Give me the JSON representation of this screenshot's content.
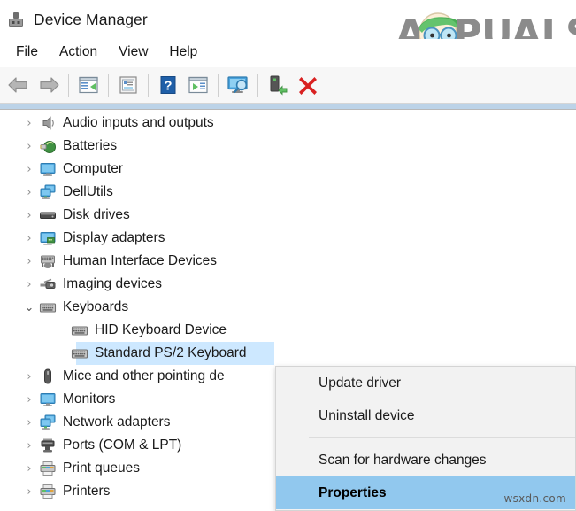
{
  "window": {
    "title": "Device Manager",
    "title_icon": "device-manager-icon"
  },
  "brand": {
    "text": "APPUALS",
    "logo_icon": "appuals-mascot-icon",
    "color": "#8b8b8b"
  },
  "menubar": {
    "items": [
      {
        "label": "File"
      },
      {
        "label": "Action"
      },
      {
        "label": "View"
      },
      {
        "label": "Help"
      }
    ]
  },
  "toolbar": {
    "buttons": [
      {
        "name": "back-button",
        "icon": "back-arrow-icon"
      },
      {
        "name": "forward-button",
        "icon": "forward-arrow-icon"
      },
      {
        "name": "show-hide-console-tree-button",
        "icon": "console-tree-icon"
      },
      {
        "name": "properties-button",
        "icon": "properties-window-icon"
      },
      {
        "name": "help-button",
        "icon": "help-question-icon"
      },
      {
        "name": "update-driver-button",
        "icon": "update-driver-icon"
      },
      {
        "name": "scan-hardware-changes-button",
        "icon": "monitor-magnifier-icon"
      },
      {
        "name": "disable-device-button",
        "icon": "disable-device-icon"
      },
      {
        "name": "uninstall-device-button",
        "icon": "red-x-icon"
      }
    ]
  },
  "tree": {
    "nodes": [
      {
        "label": "Audio inputs and outputs",
        "icon": "speaker-icon",
        "level": 1,
        "state": "collapsed",
        "selected": false
      },
      {
        "label": "Batteries",
        "icon": "battery-plug-icon",
        "level": 1,
        "state": "collapsed",
        "selected": false
      },
      {
        "label": "Computer",
        "icon": "computer-monitor-icon",
        "level": 1,
        "state": "collapsed",
        "selected": false
      },
      {
        "label": "DellUtils",
        "icon": "multi-monitor-icon",
        "level": 1,
        "state": "collapsed",
        "selected": false
      },
      {
        "label": "Disk drives",
        "icon": "disk-drive-icon",
        "level": 1,
        "state": "collapsed",
        "selected": false
      },
      {
        "label": "Display adapters",
        "icon": "display-adapter-icon",
        "level": 1,
        "state": "collapsed",
        "selected": false
      },
      {
        "label": "Human Interface Devices",
        "icon": "hid-icon",
        "level": 1,
        "state": "collapsed",
        "selected": false
      },
      {
        "label": "Imaging devices",
        "icon": "imaging-device-icon",
        "level": 1,
        "state": "collapsed",
        "selected": false
      },
      {
        "label": "Keyboards",
        "icon": "keyboard-icon",
        "level": 1,
        "state": "expanded",
        "selected": false
      },
      {
        "label": "HID Keyboard Device",
        "icon": "keyboard-icon",
        "level": 2,
        "state": "leaf",
        "selected": false
      },
      {
        "label": "Standard PS/2 Keyboard",
        "icon": "keyboard-icon",
        "level": 2,
        "state": "leaf",
        "selected": true
      },
      {
        "label": "Mice and other pointing de",
        "icon": "mouse-icon",
        "level": 1,
        "state": "collapsed",
        "selected": false
      },
      {
        "label": "Monitors",
        "icon": "computer-monitor-icon",
        "level": 1,
        "state": "collapsed",
        "selected": false
      },
      {
        "label": "Network adapters",
        "icon": "multi-monitor-icon",
        "level": 1,
        "state": "collapsed",
        "selected": false
      },
      {
        "label": "Ports (COM & LPT)",
        "icon": "port-connector-icon",
        "level": 1,
        "state": "collapsed",
        "selected": false
      },
      {
        "label": "Print queues",
        "icon": "printer-icon",
        "level": 1,
        "state": "collapsed",
        "selected": false
      },
      {
        "label": "Printers",
        "icon": "printer-icon",
        "level": 1,
        "state": "collapsed",
        "selected": false
      }
    ],
    "chevron_collapsed": "›",
    "chevron_expanded": "⌄",
    "selection_color": "#cde8ff"
  },
  "context_menu": {
    "items": [
      {
        "label": "Update driver",
        "highlighted": false
      },
      {
        "label": "Uninstall device",
        "highlighted": false
      },
      {
        "label": "Scan for hardware changes",
        "highlighted": false
      },
      {
        "label": "Properties",
        "highlighted": true
      }
    ],
    "highlight_color": "#91c8ee",
    "watermark": "wsxdn.com"
  }
}
